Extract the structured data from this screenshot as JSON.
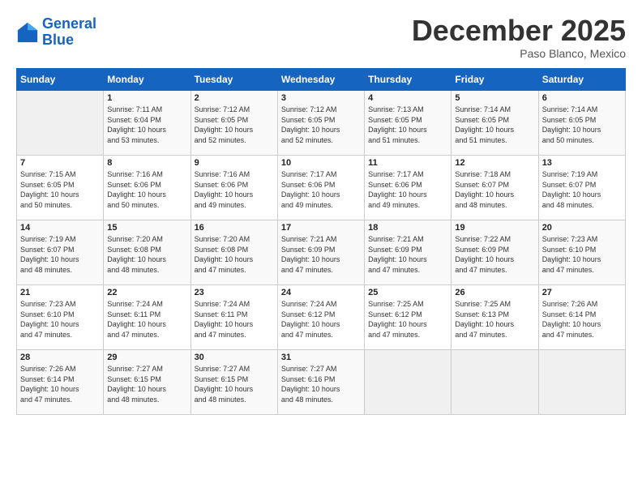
{
  "header": {
    "logo_line1": "General",
    "logo_line2": "Blue",
    "month": "December 2025",
    "location": "Paso Blanco, Mexico"
  },
  "days_of_week": [
    "Sunday",
    "Monday",
    "Tuesday",
    "Wednesday",
    "Thursday",
    "Friday",
    "Saturday"
  ],
  "weeks": [
    [
      {
        "day": "",
        "sunrise": "",
        "sunset": "",
        "daylight": ""
      },
      {
        "day": "1",
        "sunrise": "7:11 AM",
        "sunset": "6:04 PM",
        "daylight": "10 hours and 53 minutes."
      },
      {
        "day": "2",
        "sunrise": "7:12 AM",
        "sunset": "6:05 PM",
        "daylight": "10 hours and 52 minutes."
      },
      {
        "day": "3",
        "sunrise": "7:12 AM",
        "sunset": "6:05 PM",
        "daylight": "10 hours and 52 minutes."
      },
      {
        "day": "4",
        "sunrise": "7:13 AM",
        "sunset": "6:05 PM",
        "daylight": "10 hours and 51 minutes."
      },
      {
        "day": "5",
        "sunrise": "7:14 AM",
        "sunset": "6:05 PM",
        "daylight": "10 hours and 51 minutes."
      },
      {
        "day": "6",
        "sunrise": "7:14 AM",
        "sunset": "6:05 PM",
        "daylight": "10 hours and 50 minutes."
      }
    ],
    [
      {
        "day": "7",
        "sunrise": "7:15 AM",
        "sunset": "6:05 PM",
        "daylight": "10 hours and 50 minutes."
      },
      {
        "day": "8",
        "sunrise": "7:16 AM",
        "sunset": "6:06 PM",
        "daylight": "10 hours and 50 minutes."
      },
      {
        "day": "9",
        "sunrise": "7:16 AM",
        "sunset": "6:06 PM",
        "daylight": "10 hours and 49 minutes."
      },
      {
        "day": "10",
        "sunrise": "7:17 AM",
        "sunset": "6:06 PM",
        "daylight": "10 hours and 49 minutes."
      },
      {
        "day": "11",
        "sunrise": "7:17 AM",
        "sunset": "6:06 PM",
        "daylight": "10 hours and 49 minutes."
      },
      {
        "day": "12",
        "sunrise": "7:18 AM",
        "sunset": "6:07 PM",
        "daylight": "10 hours and 48 minutes."
      },
      {
        "day": "13",
        "sunrise": "7:19 AM",
        "sunset": "6:07 PM",
        "daylight": "10 hours and 48 minutes."
      }
    ],
    [
      {
        "day": "14",
        "sunrise": "7:19 AM",
        "sunset": "6:07 PM",
        "daylight": "10 hours and 48 minutes."
      },
      {
        "day": "15",
        "sunrise": "7:20 AM",
        "sunset": "6:08 PM",
        "daylight": "10 hours and 48 minutes."
      },
      {
        "day": "16",
        "sunrise": "7:20 AM",
        "sunset": "6:08 PM",
        "daylight": "10 hours and 47 minutes."
      },
      {
        "day": "17",
        "sunrise": "7:21 AM",
        "sunset": "6:09 PM",
        "daylight": "10 hours and 47 minutes."
      },
      {
        "day": "18",
        "sunrise": "7:21 AM",
        "sunset": "6:09 PM",
        "daylight": "10 hours and 47 minutes."
      },
      {
        "day": "19",
        "sunrise": "7:22 AM",
        "sunset": "6:09 PM",
        "daylight": "10 hours and 47 minutes."
      },
      {
        "day": "20",
        "sunrise": "7:23 AM",
        "sunset": "6:10 PM",
        "daylight": "10 hours and 47 minutes."
      }
    ],
    [
      {
        "day": "21",
        "sunrise": "7:23 AM",
        "sunset": "6:10 PM",
        "daylight": "10 hours and 47 minutes."
      },
      {
        "day": "22",
        "sunrise": "7:24 AM",
        "sunset": "6:11 PM",
        "daylight": "10 hours and 47 minutes."
      },
      {
        "day": "23",
        "sunrise": "7:24 AM",
        "sunset": "6:11 PM",
        "daylight": "10 hours and 47 minutes."
      },
      {
        "day": "24",
        "sunrise": "7:24 AM",
        "sunset": "6:12 PM",
        "daylight": "10 hours and 47 minutes."
      },
      {
        "day": "25",
        "sunrise": "7:25 AM",
        "sunset": "6:12 PM",
        "daylight": "10 hours and 47 minutes."
      },
      {
        "day": "26",
        "sunrise": "7:25 AM",
        "sunset": "6:13 PM",
        "daylight": "10 hours and 47 minutes."
      },
      {
        "day": "27",
        "sunrise": "7:26 AM",
        "sunset": "6:14 PM",
        "daylight": "10 hours and 47 minutes."
      }
    ],
    [
      {
        "day": "28",
        "sunrise": "7:26 AM",
        "sunset": "6:14 PM",
        "daylight": "10 hours and 47 minutes."
      },
      {
        "day": "29",
        "sunrise": "7:27 AM",
        "sunset": "6:15 PM",
        "daylight": "10 hours and 48 minutes."
      },
      {
        "day": "30",
        "sunrise": "7:27 AM",
        "sunset": "6:15 PM",
        "daylight": "10 hours and 48 minutes."
      },
      {
        "day": "31",
        "sunrise": "7:27 AM",
        "sunset": "6:16 PM",
        "daylight": "10 hours and 48 minutes."
      },
      {
        "day": "",
        "sunrise": "",
        "sunset": "",
        "daylight": ""
      },
      {
        "day": "",
        "sunrise": "",
        "sunset": "",
        "daylight": ""
      },
      {
        "day": "",
        "sunrise": "",
        "sunset": "",
        "daylight": ""
      }
    ]
  ],
  "labels": {
    "sunrise": "Sunrise:",
    "sunset": "Sunset:",
    "daylight": "Daylight:"
  }
}
